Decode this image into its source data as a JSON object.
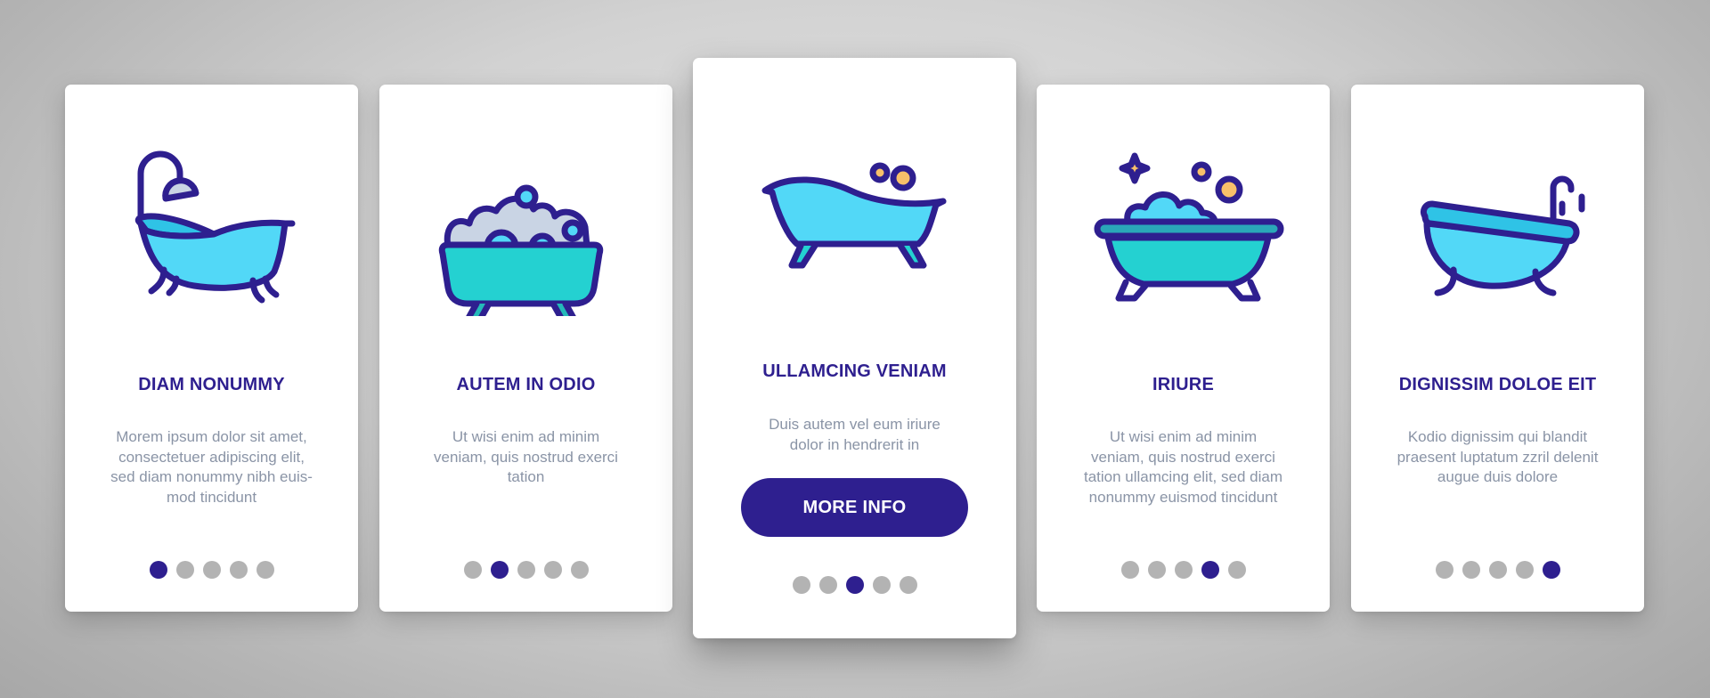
{
  "colors": {
    "accent": "#2e1f8f",
    "title": "#2e1f8f",
    "description": "#8a94a6",
    "dot_inactive": "#b3b3b3",
    "dot_active": "#2e1f8f",
    "icon_outline": "#2e1f8f",
    "icon_fill_light_blue": "#52d8f7",
    "icon_fill_teal": "#24d1d1",
    "icon_fill_foam": "#c9d4e4",
    "icon_fill_orange": "#f8c06a"
  },
  "cards": [
    {
      "icon": "clawfoot-bathtub-with-shower-icon",
      "title": "DIAM NONUMMY",
      "description": [
        "Morem ipsum dolor sit amet,",
        "consectetuer adipiscing elit,",
        "sed diam nonummy nibh euis-",
        "mod tincidunt"
      ],
      "page_index": 1,
      "page_count": 5
    },
    {
      "icon": "bathtub-with-foam-icon",
      "title": "AUTEM IN ODIO",
      "description": [
        "Ut wisi enim ad minim",
        "veniam, quis nostrud exerci",
        "tation"
      ],
      "page_index": 2,
      "page_count": 5
    },
    {
      "icon": "bathtub-with-bubbles-icon",
      "title": "ULLAMCING VENIAM",
      "description": [
        "Duis autem vel eum iriure",
        "dolor in hendrerit in"
      ],
      "button_label": "MORE INFO",
      "page_index": 3,
      "page_count": 5
    },
    {
      "icon": "clean-bathtub-with-sparkle-icon",
      "title": "IRIURE",
      "description": [
        "Ut wisi enim ad minim",
        "veniam, quis nostrud exerci",
        "tation ullamcing elit, sed diam",
        "nonummy euismod tincidunt"
      ],
      "page_index": 4,
      "page_count": 5
    },
    {
      "icon": "bathtub-with-faucet-icon",
      "title": "DIGNISSIM DOLOE EIT",
      "description": [
        "Kodio dignissim qui blandit",
        "praesent luptatum zzril delenit",
        "augue duis dolore"
      ],
      "page_index": 5,
      "page_count": 5
    }
  ]
}
